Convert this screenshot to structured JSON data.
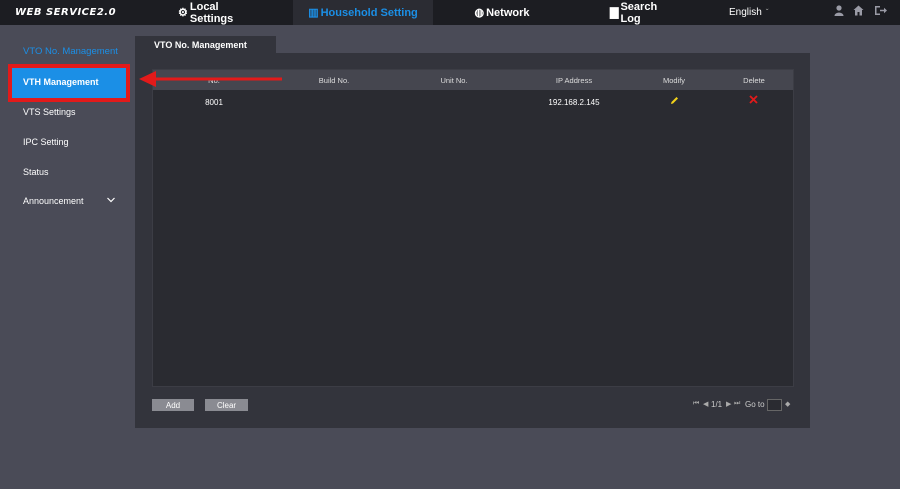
{
  "topbar": {
    "brand": "WEB SERVICE2.0",
    "nav": [
      {
        "label": "Local Settings",
        "icon": "gear-icon"
      },
      {
        "label": "Household Setting",
        "icon": "building-icon"
      },
      {
        "label": "Network",
        "icon": "globe-icon"
      },
      {
        "label": "Search Log",
        "icon": "document-icon"
      }
    ],
    "language": "English",
    "icons": [
      "user-icon",
      "home-icon",
      "logout-icon"
    ]
  },
  "sidebar": {
    "title": "VTO No. Management",
    "items": [
      {
        "label": "VTH Management",
        "active": true
      },
      {
        "label": "VTS Settings"
      },
      {
        "label": "IPC Setting"
      },
      {
        "label": "Status"
      },
      {
        "label": "Announcement",
        "expandable": true
      }
    ]
  },
  "main": {
    "tab": "VTO No. Management",
    "table": {
      "columns": [
        "No.",
        "Build No.",
        "Unit No.",
        "IP Address",
        "Modify",
        "Delete"
      ],
      "rows": [
        {
          "no": "8001",
          "build": "",
          "unit": "",
          "ip": "192.168.2.145"
        }
      ]
    },
    "buttons": {
      "add": "Add",
      "clear": "Clear"
    },
    "pager": {
      "page": "1/1",
      "goto_label": "Go to",
      "goto_value": ""
    }
  },
  "colors": {
    "accent": "#1b8fe6",
    "annotation": "#e21a1a",
    "edit": "#f2d21a"
  }
}
